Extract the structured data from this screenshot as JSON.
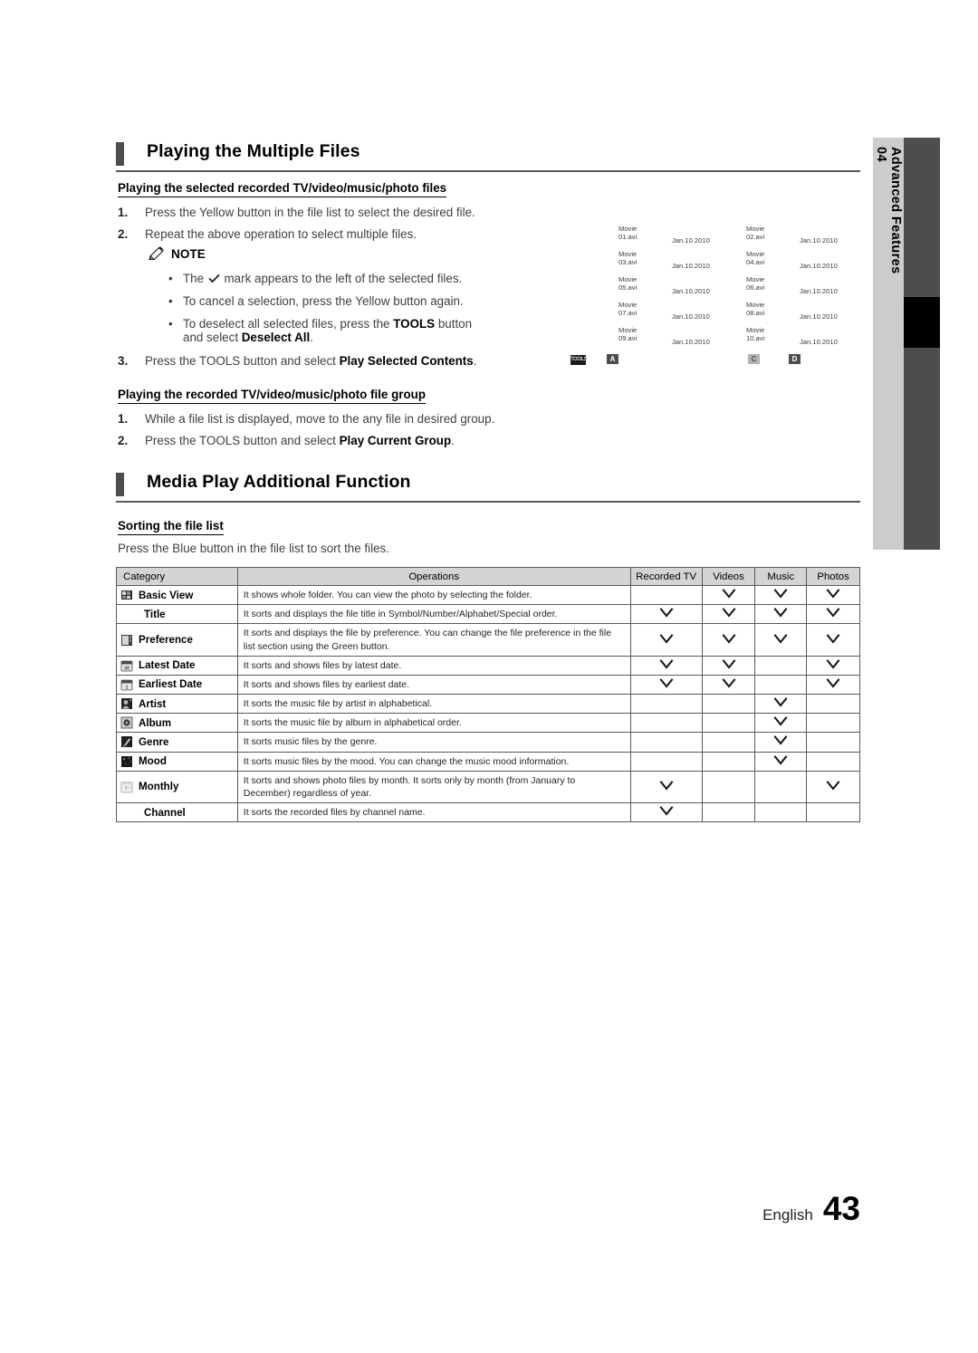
{
  "side_tab": {
    "number": "04",
    "label": "Advanced Features"
  },
  "sections": [
    {
      "title": "Playing the Multiple Files",
      "subsections": [
        {
          "heading": "Playing the selected recorded TV/video/music/photo files",
          "steps": [
            {
              "num": "1.",
              "text": "Press the Yellow button in the file list to select the desired file."
            },
            {
              "num": "2.",
              "text": "Repeat the above operation to select multiple files."
            },
            {
              "num": "3.",
              "text_pre": "Press the TOOLS button and select ",
              "text_bold": "Play Selected Contents",
              "text_post": "."
            }
          ],
          "note": {
            "label": "NOTE",
            "icon": "pencil-icon",
            "bullets": [
              {
                "pre": "The ",
                "icon": "checkmark-icon",
                "post": " mark appears to the left of the selected files."
              },
              {
                "pre": "To cancel a selection, press the Yellow button again.",
                "post": ""
              },
              {
                "pre": "To deselect all selected files, press the ",
                "bold1": "TOOLS",
                "mid": " button",
                "line2_pre": "and select ",
                "bold2": "Deselect All",
                "line2_post": "."
              }
            ]
          }
        },
        {
          "heading": "Playing the recorded TV/video/music/photo file group",
          "steps": [
            {
              "num": "1.",
              "text": "While a file list is displayed, move to the any file in desired group."
            },
            {
              "num": "2.",
              "text_pre": "Press the TOOLS button and select ",
              "text_bold": "Play Current Group",
              "text_post": "."
            }
          ]
        }
      ]
    },
    {
      "title": "Media Play Additional Function",
      "subsections": [
        {
          "heading": "Sorting the file list",
          "intro": "Press the Blue button in the file list to sort the files."
        }
      ]
    }
  ],
  "file_list_illustration": {
    "files": [
      {
        "name": "Movie 01.avi",
        "date": "Jan.10.2010"
      },
      {
        "name": "Movie 02.avi",
        "date": "Jan.10.2010"
      },
      {
        "name": "Movie 03.avi",
        "date": "Jan.10.2010"
      },
      {
        "name": "Movie 04.avi",
        "date": "Jan.10.2010"
      },
      {
        "name": "Movie 05.avi",
        "date": "Jan.10.2010"
      },
      {
        "name": "Movie 06.avi",
        "date": "Jan.10.2010"
      },
      {
        "name": "Movie 07.avi",
        "date": "Jan.10.2010"
      },
      {
        "name": "Movie 08.avi",
        "date": "Jan.10.2010"
      },
      {
        "name": "Movie 09.avi",
        "date": "Jan.10.2010"
      },
      {
        "name": "Movie 10.avi",
        "date": "Jan.10.2010"
      }
    ],
    "buttons": [
      {
        "name": "tools-button-icon",
        "label": "TOOLS"
      },
      {
        "name": "a-button-icon",
        "label": "A"
      },
      {
        "name": "c-button-icon",
        "label": "C"
      },
      {
        "name": "d-button-icon",
        "label": "D"
      }
    ]
  },
  "sort_table": {
    "headers": [
      "Category",
      "Operations",
      "Recorded TV",
      "Videos",
      "Music",
      "Photos"
    ],
    "check_symbol": "v",
    "rows": [
      {
        "category": "Basic View",
        "icon": "basic-view-icon",
        "operations": "It shows whole folder. You can view the photo by selecting the folder.",
        "recorded_tv": false,
        "videos": true,
        "music": true,
        "photos": true
      },
      {
        "category": "Title",
        "icon": "",
        "operations": "It sorts and displays the file title in Symbol/Number/Alphabet/Special order.",
        "recorded_tv": true,
        "videos": true,
        "music": true,
        "photos": true
      },
      {
        "category": "Preference",
        "icon": "preference-icon",
        "operations": "It sorts and displays the file by preference. You can change the file preference in the file list section using the Green button.",
        "recorded_tv": true,
        "videos": true,
        "music": true,
        "photos": true
      },
      {
        "category": "Latest Date",
        "icon": "latest-date-icon",
        "operations": "It sorts and shows files by latest date.",
        "recorded_tv": true,
        "videos": true,
        "music": false,
        "photos": true
      },
      {
        "category": "Earliest Date",
        "icon": "earliest-date-icon",
        "operations": "It sorts and shows files by earliest date.",
        "recorded_tv": true,
        "videos": true,
        "music": false,
        "photos": true
      },
      {
        "category": "Artist",
        "icon": "artist-icon",
        "operations": "It sorts the music file by artist in alphabetical.",
        "recorded_tv": false,
        "videos": false,
        "music": true,
        "photos": false
      },
      {
        "category": "Album",
        "icon": "album-icon",
        "operations": "It sorts the music file by album in alphabetical order.",
        "recorded_tv": false,
        "videos": false,
        "music": true,
        "photos": false
      },
      {
        "category": "Genre",
        "icon": "genre-icon",
        "operations": "It sorts music files by the genre.",
        "recorded_tv": false,
        "videos": false,
        "music": true,
        "photos": false
      },
      {
        "category": "Mood",
        "icon": "mood-icon",
        "operations": "It sorts music files by the mood. You can change the music mood information.",
        "recorded_tv": false,
        "videos": false,
        "music": true,
        "photos": false
      },
      {
        "category": "Monthly",
        "icon": "monthly-icon",
        "operations": "It sorts and shows photo files by month. It sorts only by month (from January to December) regardless of year.",
        "recorded_tv": true,
        "videos": false,
        "music": false,
        "photos": true
      },
      {
        "category": "Channel",
        "icon": "",
        "operations": "It sorts the recorded files by channel name.",
        "recorded_tv": true,
        "videos": false,
        "music": false,
        "photos": false
      }
    ]
  },
  "footer": {
    "language": "English",
    "page_number": "43"
  }
}
